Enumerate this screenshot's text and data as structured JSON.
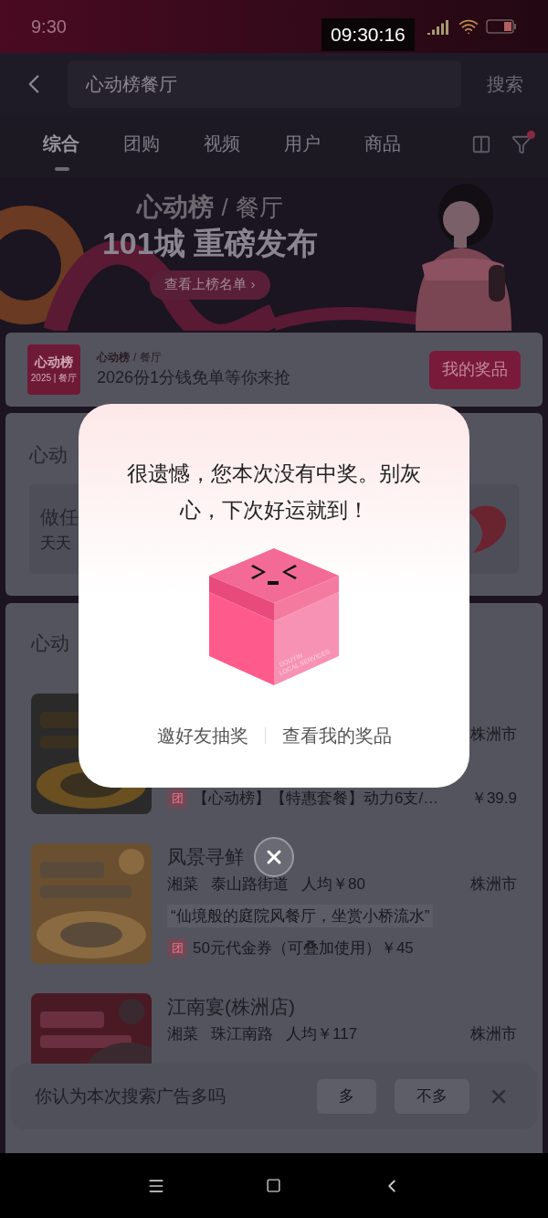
{
  "status_bar": {
    "time": "9:30",
    "clock_overlay": "09:30:16"
  },
  "search": {
    "value": "心动榜餐厅",
    "button": "搜索"
  },
  "tabs": [
    {
      "label": "综合",
      "selected": true
    },
    {
      "label": "团购",
      "selected": false
    },
    {
      "label": "视频",
      "selected": false
    },
    {
      "label": "用户",
      "selected": false
    },
    {
      "label": "商品",
      "selected": false
    }
  ],
  "filter": {
    "badge": true
  },
  "banner": {
    "brand": "心动榜",
    "separator": "/",
    "category": "餐厅",
    "headline": "101城 重磅发布",
    "button": "查看上榜名单 ›"
  },
  "promo_card": {
    "logo_title": "心动榜",
    "logo_subtitle": "2025 | 餐厅",
    "brand": "心动榜",
    "separator": "/",
    "category": "餐厅",
    "text": "2026份1分钱免单等你来抢",
    "button": "我的奖品"
  },
  "task_card": {
    "title": "心动",
    "task_title": "做任",
    "task_subtitle": "天天"
  },
  "list": {
    "title": "心动",
    "rows": [
      {
        "city": "株洲市",
        "deal_tag": "团",
        "deal": "【心动榜】【特惠套餐】动力6支/…",
        "deal_price": "￥39.9"
      },
      {
        "name": "凤景寻鲜",
        "cuisine": "湘菜",
        "area": "泰山路街道",
        "avg_price": "人均￥80",
        "city": "株洲市",
        "quote": "“仙境般的庭院风餐厅，坐赏小桥流水”",
        "deal_tag": "团",
        "deal": "50元代金券（可叠加使用）￥45"
      },
      {
        "name": "江南宴(株洲店)",
        "cuisine": "湘菜",
        "area": "珠江南路",
        "avg_price": "人均￥117",
        "city": "株洲市"
      }
    ]
  },
  "feedback": {
    "question": "你认为本次搜索广告多吗",
    "options": [
      "多",
      "不多"
    ]
  },
  "modal": {
    "message": "很遗憾，您本次没有中奖。别灰心，下次好运就到！",
    "box_label": [
      "DOUYIN",
      "LOCAL SERVICES"
    ],
    "links": [
      "邀好友抽奖",
      "查看我的奖品"
    ]
  }
}
